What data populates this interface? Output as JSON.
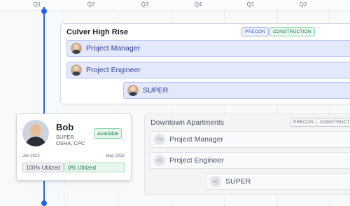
{
  "timeline": {
    "ticks": [
      "Q1",
      "Q2",
      "Q3",
      "Q4",
      "Q1",
      "Q2"
    ]
  },
  "projects": [
    {
      "name": "Culver High Rise",
      "tags": [
        "PRECON",
        "CONSTRUCTION"
      ],
      "roles": [
        {
          "label": "Project Manager",
          "avatar": "photo"
        },
        {
          "label": "Project Engineer",
          "avatar": "photo"
        },
        {
          "label": "SUPER",
          "avatar": "photo"
        }
      ]
    },
    {
      "name": "Downtown Apartments",
      "tags": [
        "PRECON",
        "CONSTRUCTION"
      ],
      "roles": [
        {
          "label": "Project Manager",
          "initials": "TM"
        },
        {
          "label": "Project Engineer",
          "initials": "VD"
        },
        {
          "label": "SUPER",
          "initials": "AD"
        }
      ]
    }
  ],
  "person_card": {
    "name": "Bob",
    "role": "SUPER",
    "certs": "OSHA, CPC",
    "status": "Available",
    "start": "Jan 2025",
    "end": "May 2026",
    "utilization": [
      "100% Utilized",
      "0% Utilized"
    ]
  },
  "colors": {
    "accent": "#2563eb",
    "assigned_bar": "#e3e8fb",
    "available": "#1f7a4a"
  }
}
